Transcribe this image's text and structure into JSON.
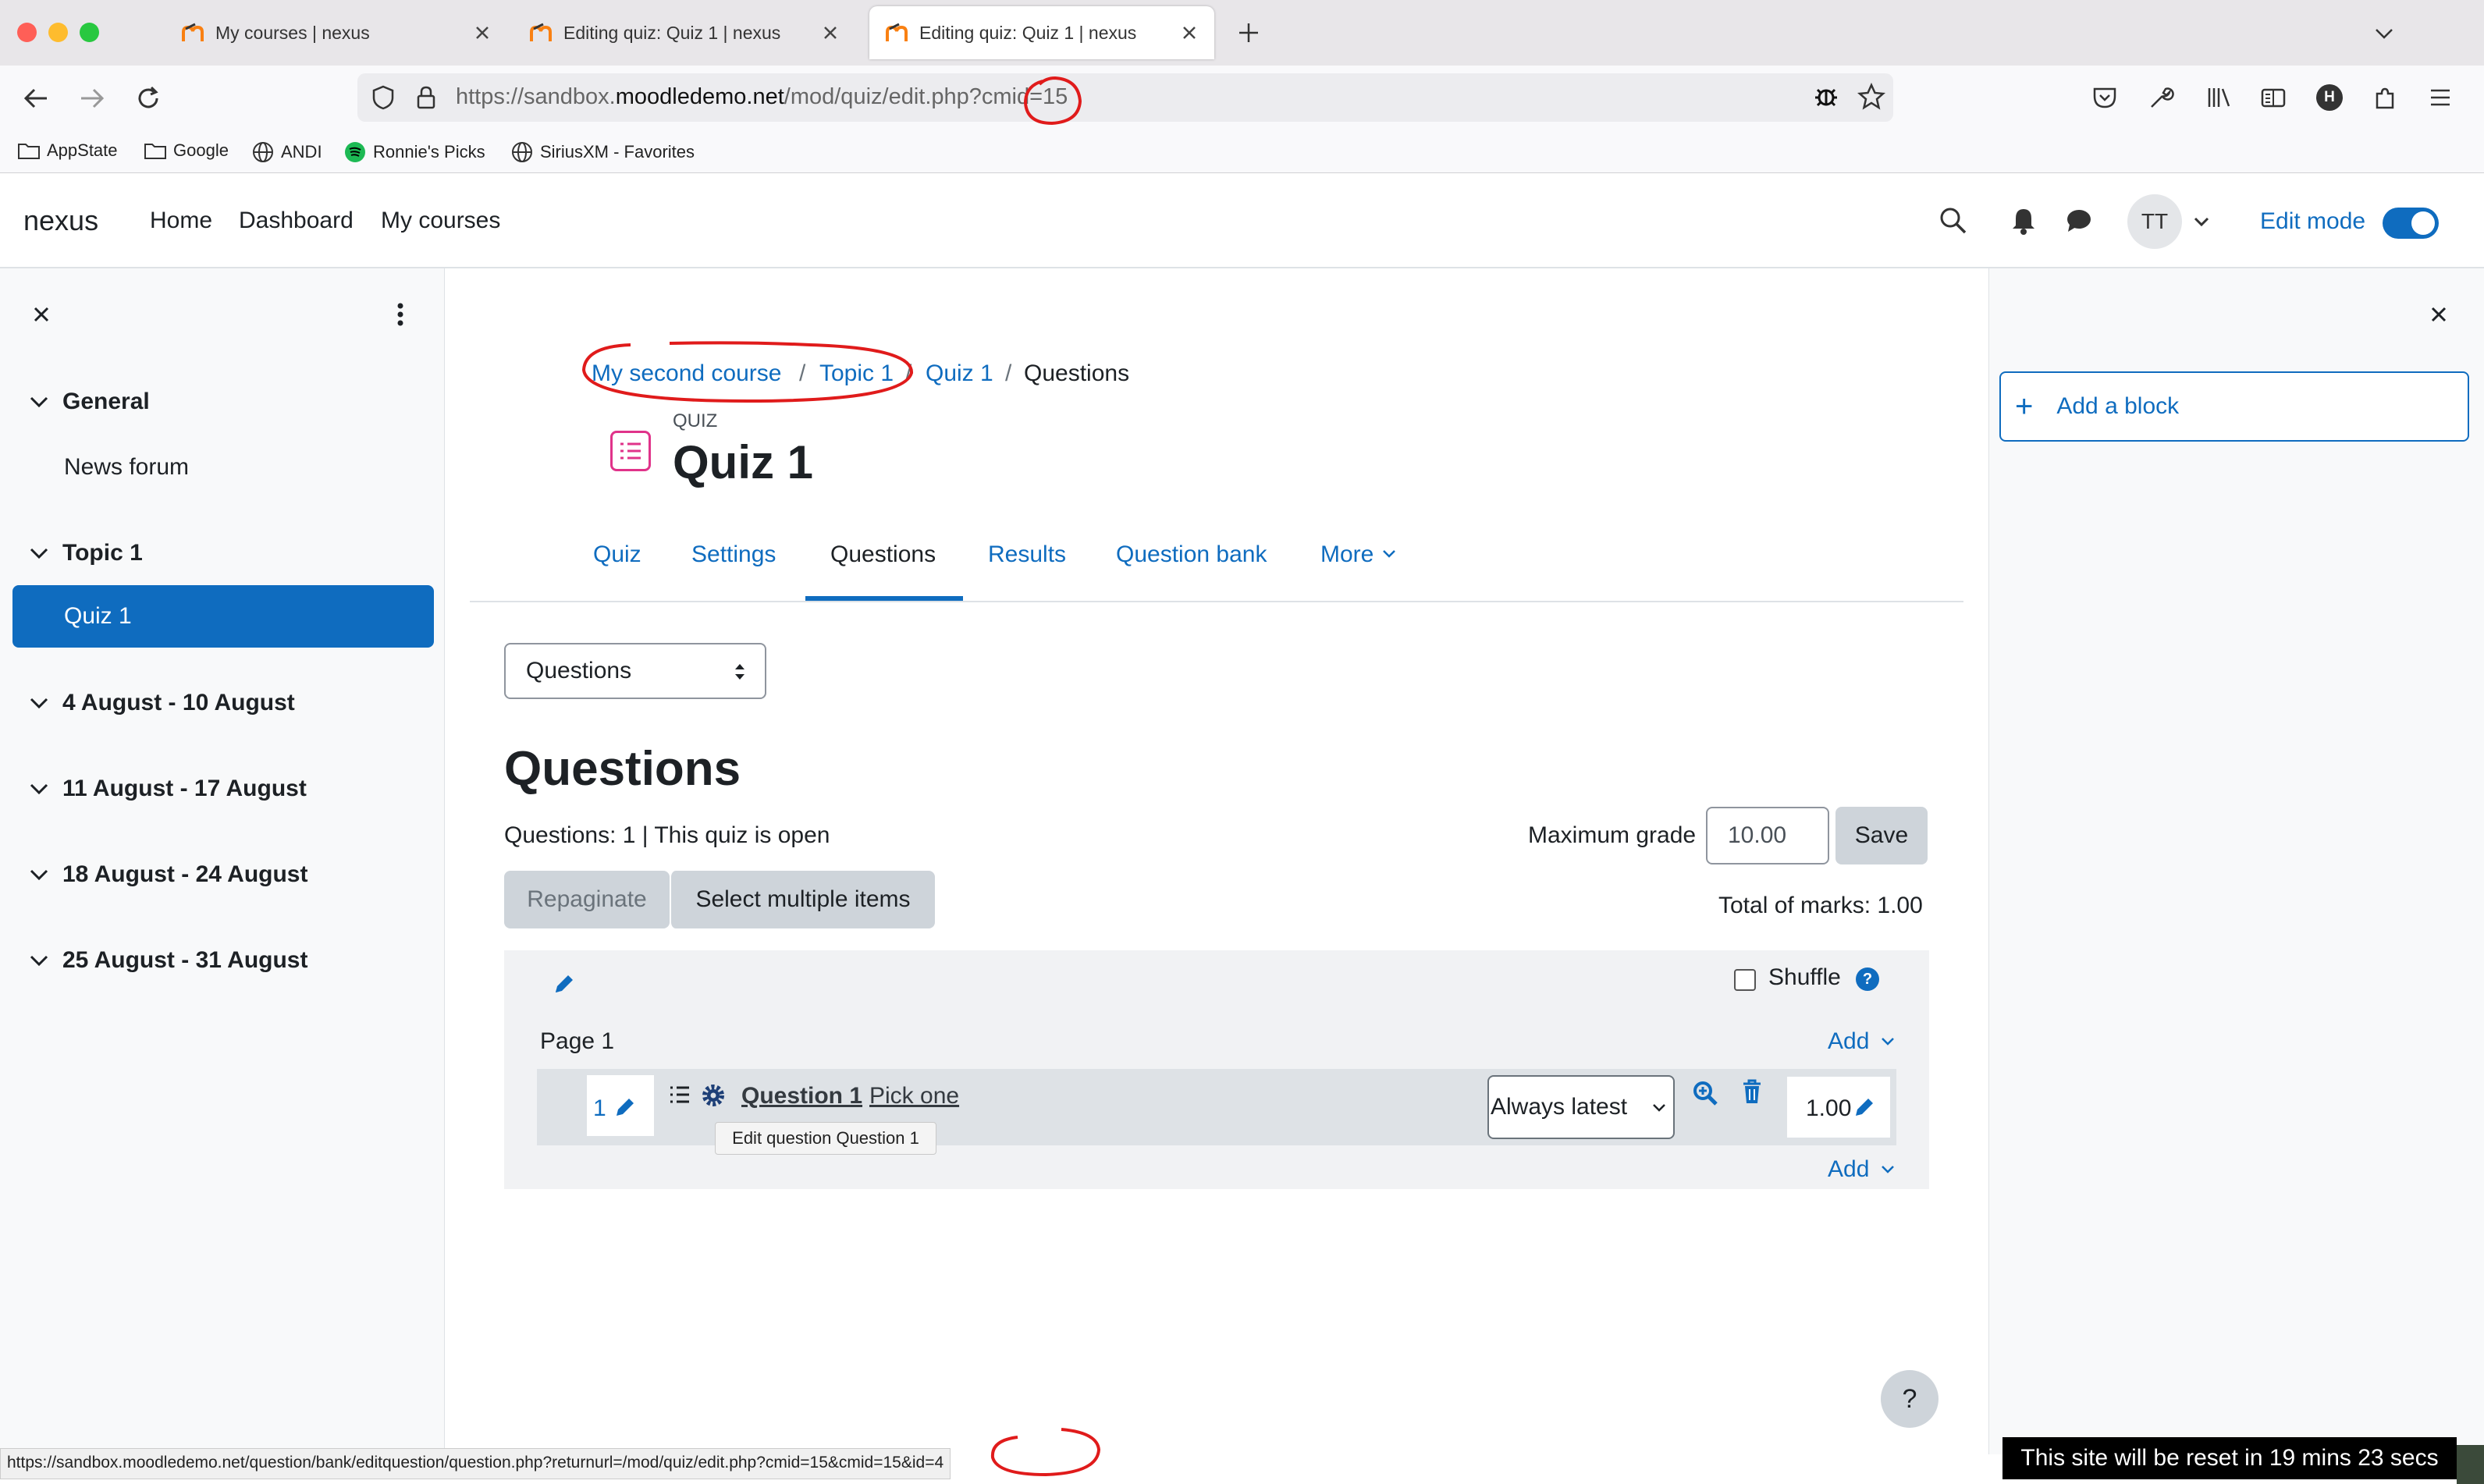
{
  "browser": {
    "tabs": [
      {
        "title": "My courses | nexus"
      },
      {
        "title": "Editing quiz: Quiz 1 | nexus"
      },
      {
        "title": "Editing quiz: Quiz 1 | nexus"
      }
    ],
    "url": {
      "prefix": "https://sandbox.",
      "domain": "moodledemo.net",
      "path": "/mod/quiz/edit.php?cmid=15"
    },
    "bookmarks": [
      "AppState",
      "Google",
      "ANDI",
      "Ronnie's Picks",
      "SiriusXM - Favorites"
    ],
    "profile_initial": "H"
  },
  "navbar": {
    "brand": "nexus",
    "links": [
      "Home",
      "Dashboard",
      "My courses"
    ],
    "avatar_initials": "TT",
    "edit_mode_label": "Edit mode",
    "edit_mode_on": true
  },
  "course_index": {
    "sections": [
      {
        "title": "General",
        "items": [
          "News forum"
        ]
      },
      {
        "title": "Topic 1",
        "items": [
          "Quiz 1"
        ]
      },
      {
        "title": "4 August - 10 August"
      },
      {
        "title": "11 August - 17 August"
      },
      {
        "title": "18 August - 24 August"
      },
      {
        "title": "25 August - 31 August"
      }
    ]
  },
  "breadcrumb": [
    "My second course",
    "Topic 1",
    "Quiz 1",
    "Questions"
  ],
  "header": {
    "kicker": "QUIZ",
    "title": "Quiz 1"
  },
  "secondary_nav": [
    "Quiz",
    "Settings",
    "Questions",
    "Results",
    "Question bank",
    "More"
  ],
  "page_select": "Questions",
  "questions": {
    "heading": "Questions",
    "status": "Questions: 1 | This quiz is open",
    "max_grade_label": "Maximum grade",
    "max_grade_value": "10.00",
    "save_label": "Save",
    "repaginate_label": "Repaginate",
    "select_multiple_label": "Select multiple items",
    "total_marks": "Total of marks: 1.00",
    "shuffle_label": "Shuffle",
    "page_label": "Page 1",
    "add_label": "Add",
    "slot": {
      "number": "1",
      "name": "Question 1",
      "text": "Pick one",
      "version": "Always latest",
      "mark": "1.00",
      "tooltip": "Edit question Question 1"
    }
  },
  "right_drawer": {
    "add_block": "Add a block"
  },
  "status_bar_url": "https://sandbox.moodledemo.net/question/bank/editquestion/question.php?returnurl=/mod/quiz/edit.php?cmid=15&cmid=15&id=4",
  "reset_notice": "This site will be reset in 19 mins 23 secs",
  "colors": {
    "primary": "#0f6cbf",
    "annotation": "#e01b1b"
  }
}
